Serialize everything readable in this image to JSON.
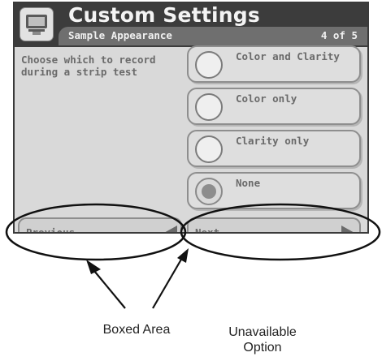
{
  "header": {
    "title": "Custom Settings",
    "subtitle": "Sample Appearance",
    "page_indicator": "4 of 5",
    "icon": "printer-icon"
  },
  "instruction": "Choose which to record during a strip test",
  "options": [
    {
      "label": "Color and Clarity",
      "selected": false
    },
    {
      "label": "Color only",
      "selected": false
    },
    {
      "label": "Clarity only",
      "selected": false
    },
    {
      "label": "None",
      "selected": true
    }
  ],
  "nav": {
    "previous_label": "Previous",
    "next_label": "Next",
    "previous_icon": "arrow-left-icon",
    "next_icon": "arrow-right-icon"
  },
  "annotations": {
    "boxed_area": "Boxed Area",
    "unavailable_option_line1": "Unavailable",
    "unavailable_option_line2": "Option"
  },
  "colors": {
    "header_bg": "#3c3c3c",
    "subheader_bg": "#6f6f6f",
    "screen_bg": "#d9d9d9",
    "text": "#6a6a6a"
  }
}
